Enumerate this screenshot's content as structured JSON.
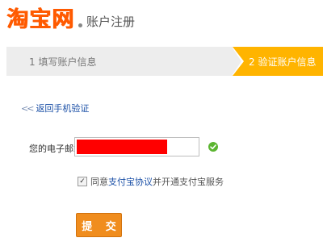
{
  "header": {
    "logo": "淘宝网",
    "subtitle": "账户注册"
  },
  "steps": [
    {
      "label": "1 填写账户信息",
      "state": "done"
    },
    {
      "label": "2 验证账户信息",
      "state": "active"
    }
  ],
  "back_link": {
    "label": "返回手机验证"
  },
  "email": {
    "label": "您的电子邮箱：",
    "value": "",
    "redacted_color": "#ff0000"
  },
  "agreement": {
    "checked": true,
    "prefix": "同意",
    "link": "支付宝协议",
    "suffix": "并开通支付宝服务"
  },
  "submit_label": "提 交",
  "colors": {
    "brand": "#ff5a00",
    "step_active": "#ffb400",
    "link": "#1a4fa6",
    "submit": "#f08d1e",
    "valid": "#5cb531"
  }
}
